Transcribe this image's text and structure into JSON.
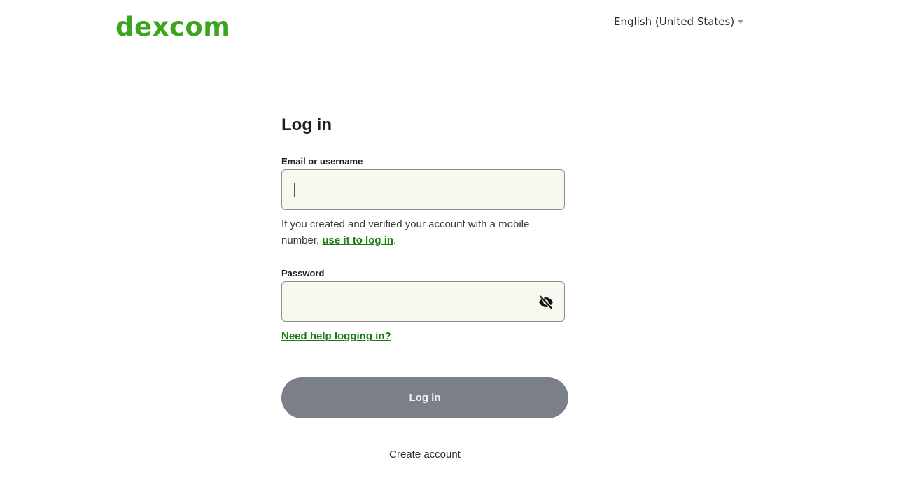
{
  "header": {
    "logo_text": "Dexcom",
    "language": "English (United States)"
  },
  "login": {
    "title": "Log in",
    "email_label": "Email or username",
    "email_value": "",
    "helper_prefix": "If you created and verified your account with a mobile number, ",
    "helper_link": "use it to log in",
    "helper_suffix": ".",
    "password_label": "Password",
    "password_value": "",
    "password_toggle_icon": "eye-slash-icon",
    "help_link": "Need help logging in?",
    "submit_label": "Log in",
    "create_account": "Create account"
  },
  "colors": {
    "brand": "#3ba51f",
    "link": "#1e7a12",
    "button_disabled": "#7a7f88",
    "input_bg": "#f8f8f1"
  }
}
